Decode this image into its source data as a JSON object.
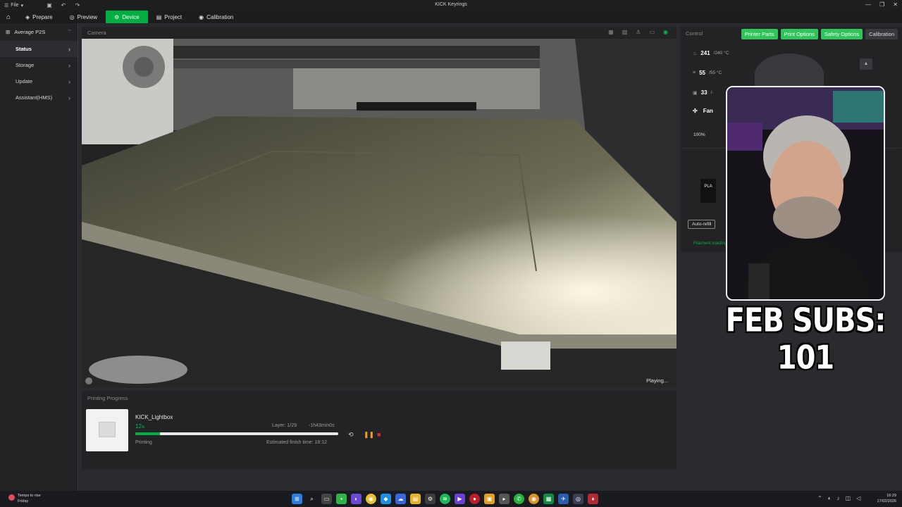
{
  "titlebar": {
    "file_label": "File",
    "title": "KICK Keyrings",
    "window_controls": [
      "—",
      "❐",
      "✕"
    ]
  },
  "navbar": {
    "tabs": [
      {
        "label": "Prepare",
        "icon": "cube-icon"
      },
      {
        "label": "Preview",
        "icon": "eye-icon"
      },
      {
        "label": "Device",
        "icon": "device-icon",
        "active": true
      },
      {
        "label": "Project",
        "icon": "project-icon"
      },
      {
        "label": "Calibration",
        "icon": "calibration-icon"
      }
    ]
  },
  "sidebar": {
    "printer_name": "Average P2S",
    "items": [
      {
        "label": "Status",
        "active": true
      },
      {
        "label": "Storage"
      },
      {
        "label": "Update"
      },
      {
        "label": "Assistant(HMS)"
      }
    ]
  },
  "camera": {
    "header": "Camera",
    "status": "Playing..."
  },
  "progress": {
    "header": "Printing Progress",
    "job_name": "KICK_Lightbox",
    "percent_value": "12",
    "percent_unit": "%",
    "fraction": 0.12,
    "layer": "Layer: 1/29",
    "remaining": "-1h43min0s",
    "status": "Printing",
    "estimated_finish": "Estimated finish time: 18:12"
  },
  "control": {
    "header": "Control",
    "buttons": [
      "Printer Parts",
      "Print Options",
      "Safety Options",
      "Calibration"
    ],
    "nozzle_temp": "241",
    "nozzle_target": "/240 °C",
    "bed_temp": "55",
    "bed_target": "/55 °C",
    "chamber_temp": "33",
    "chamber_target": "/-",
    "fan_label": "Fan",
    "fan_percent": "100%",
    "filament_type": "PLA",
    "auto_refill": "Auto-refill",
    "filament_hint": "Filament loading"
  },
  "overlay": {
    "subs_text": "FEB SUBS: 101"
  },
  "taskbar": {
    "weather_line1": "Temps to rise",
    "weather_line2": "Friday",
    "time": "16:29",
    "date": "17/02/2026"
  },
  "colors": {
    "accent": "#00ae42",
    "pill": "#2fc55b",
    "stop": "#e02a2a",
    "pause": "#f0a020"
  }
}
